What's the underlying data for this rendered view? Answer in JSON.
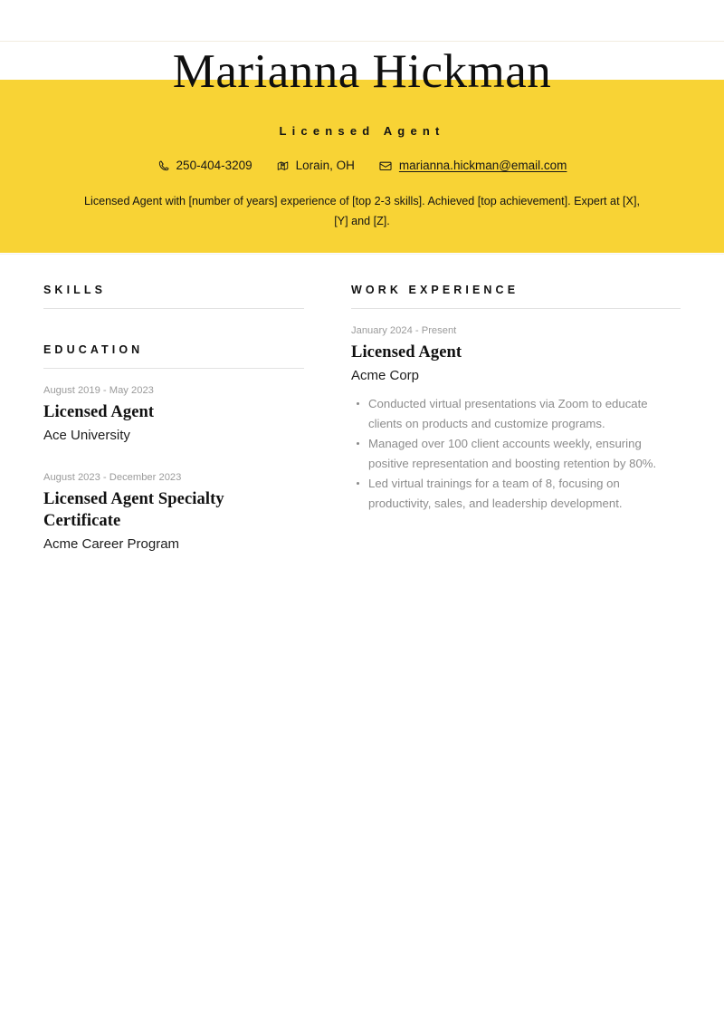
{
  "theme": {
    "accent_color": "#f8d335",
    "text_color": "#111111",
    "muted_color": "#8c8c8c",
    "date_color": "#9b9b9b",
    "rule_color": "#e2e2e2",
    "background": "#ffffff"
  },
  "header": {
    "name": "Marianna Hickman",
    "job_title": "Licensed Agent",
    "summary": "Licensed Agent with [number of years] experience of [top 2-3 skills]. Achieved [top achievement]. Expert at [X], [Y] and [Z].",
    "contacts": [
      {
        "icon": "phone-icon",
        "label": "250-404-3209",
        "is_link": false
      },
      {
        "icon": "location-icon",
        "label": "Lorain, OH",
        "is_link": false
      },
      {
        "icon": "envelope-icon",
        "label": "marianna.hickman@email.com",
        "is_link": true
      }
    ]
  },
  "left_column": {
    "skills": {
      "title": "SKILLS",
      "items": []
    },
    "education": {
      "title": "EDUCATION",
      "entries": [
        {
          "date": "August 2019 - May 2023",
          "title": "Licensed Agent",
          "organization": "Ace University"
        },
        {
          "date": "August 2023 - December 2023",
          "title": "Licensed Agent Specialty Certificate",
          "organization": "Acme Career Program"
        }
      ]
    }
  },
  "right_column": {
    "work_experience": {
      "title": "WORK EXPERIENCE",
      "entries": [
        {
          "date": "January 2024 - Present",
          "title": "Licensed Agent",
          "organization": "Acme Corp",
          "bullets": [
            "Conducted virtual presentations via Zoom to educate clients on products and customize programs.",
            "Managed over 100 client accounts weekly, ensuring positive representation and boosting retention by 80%.",
            "Led virtual trainings for a team of 8, focusing on productivity, sales, and leadership development."
          ]
        }
      ]
    }
  }
}
